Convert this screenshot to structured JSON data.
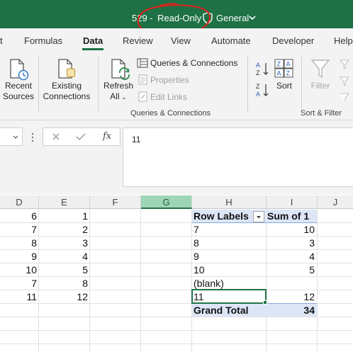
{
  "titlebar": {
    "file_name": "529",
    "separator": "-",
    "mode": "Read-Only",
    "sensitivity": "General"
  },
  "tabs": [
    {
      "label": "t"
    },
    {
      "label": "Formulas"
    },
    {
      "label": "Data",
      "active": true
    },
    {
      "label": "Review"
    },
    {
      "label": "View"
    },
    {
      "label": "Automate"
    },
    {
      "label": "Developer"
    },
    {
      "label": "Help"
    }
  ],
  "ribbon": {
    "recent_sources": {
      "line1": "Recent",
      "line2": "Sources"
    },
    "existing_connections": {
      "line1": "Existing",
      "line2": "Connections"
    },
    "refresh_all": {
      "line1": "Refresh",
      "line2": "All"
    },
    "queries_connections": "Queries & Connections",
    "properties": "Properties",
    "edit_links": "Edit Links",
    "group_queries": "Queries & Connections",
    "sort": "Sort",
    "filter": "Filter",
    "group_sort_filter": "Sort & Filter"
  },
  "formula_bar": {
    "value": "11",
    "fx_label": "fx"
  },
  "columns": [
    "D",
    "E",
    "F",
    "G",
    "H",
    "I",
    "J"
  ],
  "rows": [
    {
      "D": "6",
      "E": "1"
    },
    {
      "D": "7",
      "E": "2"
    },
    {
      "D": "8",
      "E": "3"
    },
    {
      "D": "9",
      "E": "4"
    },
    {
      "D": "10",
      "E": "5"
    },
    {
      "D": "7",
      "E": "8"
    },
    {
      "D": "11",
      "E": "12"
    }
  ],
  "pivot": {
    "header_labels": "Row Labels",
    "header_values": "Sum of 1",
    "items": [
      {
        "label": "7",
        "value": "10"
      },
      {
        "label": "8",
        "value": "3"
      },
      {
        "label": "9",
        "value": "4"
      },
      {
        "label": "10",
        "value": "5"
      },
      {
        "label": "(blank)",
        "value": ""
      },
      {
        "label": "11",
        "value": "12"
      }
    ],
    "total_label": "Grand Total",
    "total_value": "34"
  },
  "colors": {
    "title_green": "#1e7145",
    "selected_col": "#9fd5b7",
    "pivot_fill": "#dce6f7",
    "annotation_red": "#e0201b"
  }
}
